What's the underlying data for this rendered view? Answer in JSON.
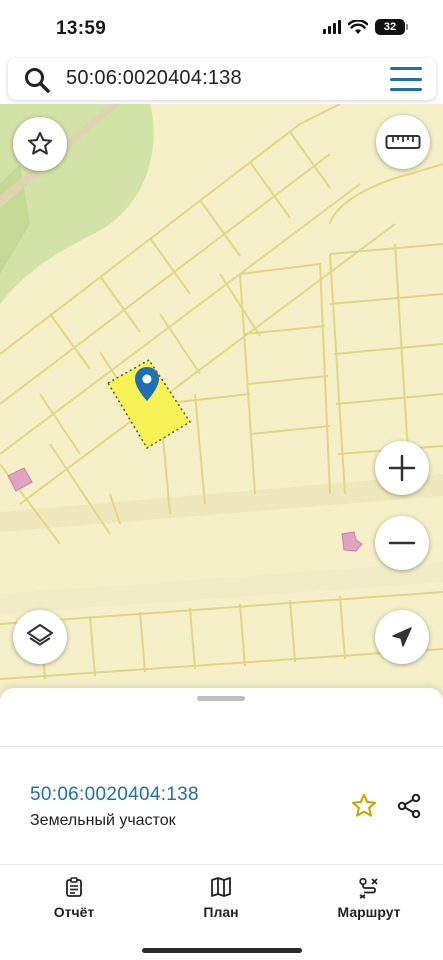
{
  "status_bar": {
    "time": "13:59",
    "battery": "32"
  },
  "search": {
    "query": "50:06:0020404:138",
    "icon": "search-icon",
    "menu_icon": "hamburger-menu-icon"
  },
  "map": {
    "controls": {
      "favorite": "star-icon",
      "ruler": "ruler-icon",
      "zoom_in": "plus-icon",
      "zoom_out": "minus-icon",
      "layers": "layers-icon",
      "locate": "navigation-arrow-icon"
    },
    "colors": {
      "background": "#f5f0c8",
      "parcel_lines": "#e6d98a",
      "selected_parcel": "#f7f356",
      "marker": "#1f6fb2",
      "green_area": "#c9dd9a"
    }
  },
  "sheet": {
    "parcel_id": "50:06:0020404:138",
    "parcel_type": "Земельный участок"
  },
  "tabbar": {
    "tabs": [
      {
        "label": "Отчёт",
        "icon": "report-icon"
      },
      {
        "label": "План",
        "icon": "map-plan-icon"
      },
      {
        "label": "Маршрут",
        "icon": "route-icon"
      }
    ]
  }
}
